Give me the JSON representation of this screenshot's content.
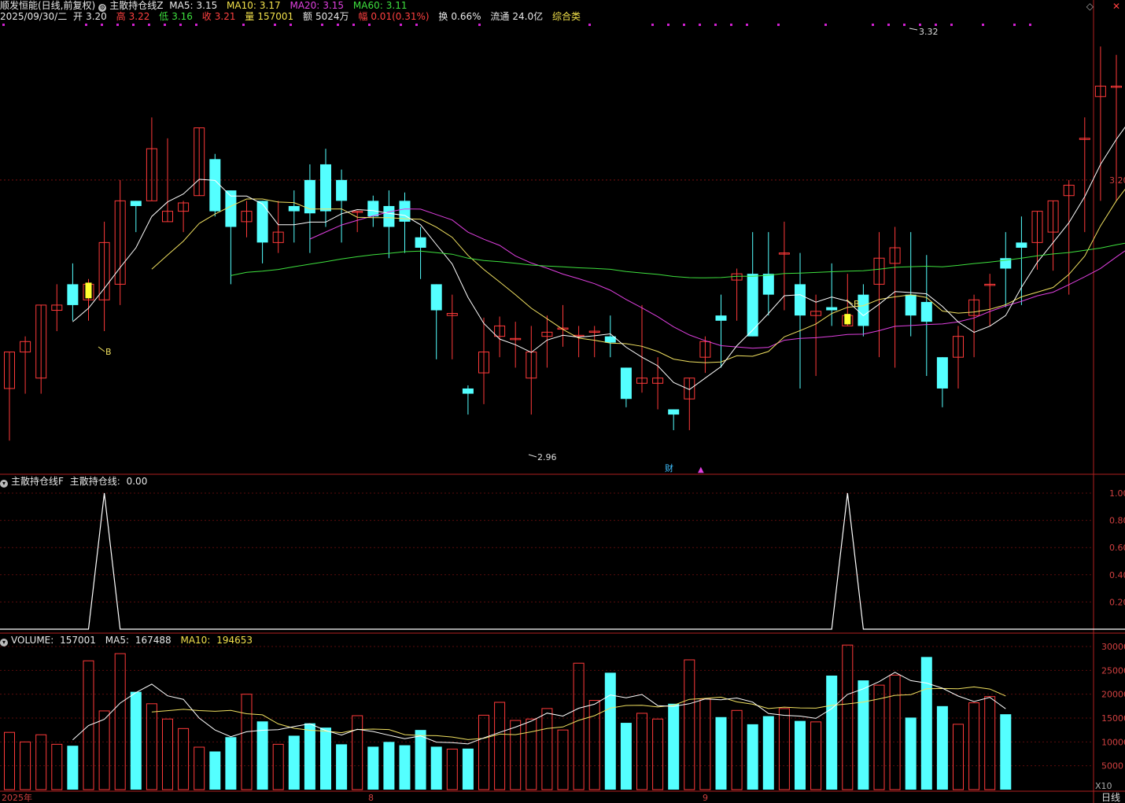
{
  "header": {
    "stock": "顺发恒能(日线,前复权)",
    "indicator": "主散持仓线Z",
    "ma5_label": "MA5:",
    "ma5_value": "3.15",
    "ma10_label": "MA10:",
    "ma10_value": "3.17",
    "ma20_label": "MA20:",
    "ma20_value": "3.15",
    "ma60_label": "MA60:",
    "ma60_value": "3.11",
    "line2_date": "2025/09/30/二",
    "open_label": "开",
    "open_value": "3.20",
    "high_label": "高",
    "high_value": "3.22",
    "low_label": "低",
    "low_value": "3.16",
    "close_label": "收",
    "close_value": "3.21",
    "vol_label": "量",
    "vol_value": "157001",
    "amount_label": "额",
    "amount_value": "5024万",
    "change_label": "幅",
    "change_value": "0.01(0.31%)",
    "turnover_label": "换",
    "turnover_value": "0.66%",
    "float_label": "流通",
    "float_value": "24.0亿",
    "category": "综合类"
  },
  "panel2_header": {
    "name": "主散持仓线F",
    "series_label": "主散持仓线:",
    "series_value": "0.00"
  },
  "panel3_header": {
    "name": "VOLUME:",
    "value": "157001",
    "ma5_label": "MA5:",
    "ma5_value": "167488",
    "ma10_label": "MA10:",
    "ma10_value": "194653"
  },
  "labels": {
    "price_max": "3.32",
    "price_min": "2.96",
    "b_mark": "B",
    "cai_mark": "财",
    "right_price": "3.20",
    "vol_unit": "X10",
    "period": "日线",
    "x_ticks": [
      "2025年",
      "8",
      "9"
    ]
  },
  "colors": {
    "up": "#ff3a3a",
    "down": "#54ffff",
    "ma5": "#ffffff",
    "ma10": "#f0e060",
    "ma20": "#e040e0",
    "ma60": "#3ee03e"
  },
  "chart_data": [
    {
      "type": "candlestick",
      "title": "主散持仓线Z",
      "ylim": [
        2.92,
        3.35
      ],
      "yticks": [
        "3.20"
      ],
      "candles": [
        {
          "o": 3.0,
          "h": 3.035,
          "l": 2.95,
          "c": 3.035
        },
        {
          "o": 3.035,
          "h": 3.05,
          "l": 2.995,
          "c": 3.045
        },
        {
          "o": 3.01,
          "h": 3.08,
          "l": 2.995,
          "c": 3.08
        },
        {
          "o": 3.075,
          "h": 3.1,
          "l": 3.055,
          "c": 3.08
        },
        {
          "o": 3.1,
          "h": 3.12,
          "l": 3.065,
          "c": 3.08
        },
        {
          "o": 3.085,
          "h": 3.105,
          "l": 3.065,
          "c": 3.1
        },
        {
          "o": 3.085,
          "h": 3.16,
          "l": 3.055,
          "c": 3.14
        },
        {
          "o": 3.1,
          "h": 3.2,
          "l": 3.08,
          "c": 3.18
        },
        {
          "o": 3.18,
          "h": 3.16,
          "l": 3.15,
          "c": 3.175
        },
        {
          "o": 3.18,
          "h": 3.26,
          "l": 3.18,
          "c": 3.23
        },
        {
          "o": 3.16,
          "h": 3.24,
          "l": 3.16,
          "c": 3.17
        },
        {
          "o": 3.17,
          "h": 3.18,
          "l": 3.15,
          "c": 3.178
        },
        {
          "o": 3.185,
          "h": 3.25,
          "l": 3.185,
          "c": 3.25
        },
        {
          "o": 3.22,
          "h": 3.225,
          "l": 3.165,
          "c": 3.17
        },
        {
          "o": 3.19,
          "h": 3.19,
          "l": 3.1,
          "c": 3.155
        },
        {
          "o": 3.16,
          "h": 3.18,
          "l": 3.145,
          "c": 3.17
        },
        {
          "o": 3.18,
          "h": 3.18,
          "l": 3.12,
          "c": 3.14
        },
        {
          "o": 3.14,
          "h": 3.18,
          "l": 3.13,
          "c": 3.15
        },
        {
          "o": 3.175,
          "h": 3.19,
          "l": 3.14,
          "c": 3.17
        },
        {
          "o": 3.2,
          "h": 3.215,
          "l": 3.13,
          "c": 3.168
        },
        {
          "o": 3.215,
          "h": 3.23,
          "l": 3.155,
          "c": 3.17
        },
        {
          "o": 3.2,
          "h": 3.21,
          "l": 3.14,
          "c": 3.18
        },
        {
          "o": 3.17,
          "h": 3.17,
          "l": 3.15,
          "c": 3.17
        },
        {
          "o": 3.18,
          "h": 3.185,
          "l": 3.155,
          "c": 3.165
        },
        {
          "o": 3.175,
          "h": 3.19,
          "l": 3.125,
          "c": 3.155
        },
        {
          "o": 3.18,
          "h": 3.188,
          "l": 3.13,
          "c": 3.16
        },
        {
          "o": 3.145,
          "h": 3.155,
          "l": 3.105,
          "c": 3.135
        },
        {
          "o": 3.1,
          "h": 3.1,
          "l": 3.028,
          "c": 3.075
        },
        {
          "o": 3.07,
          "h": 3.09,
          "l": 3.028,
          "c": 3.072
        },
        {
          "o": 3.0,
          "h": 3.003,
          "l": 2.975,
          "c": 2.995
        },
        {
          "o": 3.015,
          "h": 3.068,
          "l": 2.985,
          "c": 3.035
        },
        {
          "o": 3.05,
          "h": 3.069,
          "l": 3.03,
          "c": 3.06
        },
        {
          "o": 3.048,
          "h": 3.064,
          "l": 3.02,
          "c": 3.048
        },
        {
          "o": 3.01,
          "h": 3.06,
          "l": 2.975,
          "c": 3.035
        },
        {
          "o": 3.05,
          "h": 3.07,
          "l": 3.02,
          "c": 3.054
        },
        {
          "o": 3.058,
          "h": 3.08,
          "l": 3.04,
          "c": 3.058
        },
        {
          "o": 3.05,
          "h": 3.06,
          "l": 3.03,
          "c": 3.051
        },
        {
          "o": 3.055,
          "h": 3.06,
          "l": 3.03,
          "c": 3.055
        },
        {
          "o": 3.05,
          "h": 3.07,
          "l": 3.03,
          "c": 3.044
        },
        {
          "o": 3.02,
          "h": 3.02,
          "l": 2.982,
          "c": 2.99
        },
        {
          "o": 3.005,
          "h": 3.08,
          "l": 2.996,
          "c": 3.01
        },
        {
          "o": 3.005,
          "h": 3.03,
          "l": 2.98,
          "c": 3.01
        },
        {
          "o": 2.98,
          "h": 2.96,
          "l": 2.96,
          "c": 2.975
        },
        {
          "o": 2.99,
          "h": 3.005,
          "l": 2.96,
          "c": 3.01
        },
        {
          "o": 3.03,
          "h": 3.05,
          "l": 3.015,
          "c": 3.045
        },
        {
          "o": 3.07,
          "h": 3.09,
          "l": 3.02,
          "c": 3.065
        },
        {
          "o": 3.104,
          "h": 3.115,
          "l": 3.065,
          "c": 3.11
        },
        {
          "o": 3.11,
          "h": 3.15,
          "l": 3.05,
          "c": 3.05
        },
        {
          "o": 3.11,
          "h": 3.15,
          "l": 3.07,
          "c": 3.09
        },
        {
          "o": 3.13,
          "h": 3.16,
          "l": 3.075,
          "c": 3.13
        },
        {
          "o": 3.1,
          "h": 3.13,
          "l": 3.0,
          "c": 3.07
        },
        {
          "o": 3.07,
          "h": 3.09,
          "l": 3.012,
          "c": 3.074
        },
        {
          "o": 3.078,
          "h": 3.12,
          "l": 3.06,
          "c": 3.075
        },
        {
          "o": 3.06,
          "h": 3.11,
          "l": 3.06,
          "c": 3.07
        },
        {
          "o": 3.09,
          "h": 3.1,
          "l": 3.05,
          "c": 3.06
        },
        {
          "o": 3.1,
          "h": 3.15,
          "l": 3.03,
          "c": 3.125
        },
        {
          "o": 3.12,
          "h": 3.155,
          "l": 3.02,
          "c": 3.135
        },
        {
          "o": 3.09,
          "h": 3.15,
          "l": 3.05,
          "c": 3.07
        },
        {
          "o": 3.083,
          "h": 3.128,
          "l": 3.012,
          "c": 3.064
        },
        {
          "o": 3.03,
          "h": 3.028,
          "l": 2.982,
          "c": 3.0
        },
        {
          "o": 3.03,
          "h": 3.06,
          "l": 3.0,
          "c": 3.05
        },
        {
          "o": 3.07,
          "h": 3.09,
          "l": 3.03,
          "c": 3.085
        },
        {
          "o": 3.1,
          "h": 3.11,
          "l": 3.06,
          "c": 3.1
        },
        {
          "o": 3.125,
          "h": 3.15,
          "l": 3.078,
          "c": 3.115
        },
        {
          "o": 3.14,
          "h": 3.165,
          "l": 3.08,
          "c": 3.135
        },
        {
          "o": 3.14,
          "h": 3.17,
          "l": 3.114,
          "c": 3.17
        },
        {
          "o": 3.15,
          "h": 3.18,
          "l": 3.113,
          "c": 3.18
        },
        {
          "o": 3.185,
          "h": 3.2,
          "l": 3.09,
          "c": 3.195
        },
        {
          "o": 3.24,
          "h": 3.26,
          "l": 3.15,
          "c": 3.24
        },
        {
          "o": 3.28,
          "h": 3.328,
          "l": 3.18,
          "c": 3.29
        },
        {
          "o": 3.29,
          "h": 3.32,
          "l": 3.18,
          "c": 3.29
        },
        {
          "o": 3.25,
          "h": 3.328,
          "l": 3.185,
          "c": 3.285
        },
        {
          "o": 3.25,
          "h": 3.27,
          "l": 3.15,
          "c": 3.22
        },
        {
          "o": 3.21,
          "h": 3.23,
          "l": 3.18,
          "c": 3.215
        },
        {
          "o": 3.17,
          "h": 3.2,
          "l": 3.11,
          "c": 3.185
        },
        {
          "o": 3.17,
          "h": 3.17,
          "l": 3.04,
          "c": 3.06
        },
        {
          "o": 3.06,
          "h": 3.11,
          "l": 3.01,
          "c": 3.08
        },
        {
          "o": 3.15,
          "h": 3.19,
          "l": 3.07,
          "c": 3.18
        },
        {
          "o": 3.18,
          "h": 3.2,
          "l": 3.1,
          "c": 3.1
        },
        {
          "o": 3.12,
          "h": 3.205,
          "l": 3.09,
          "c": 3.19
        },
        {
          "o": 3.2,
          "h": 3.22,
          "l": 3.16,
          "c": 3.21
        }
      ]
    },
    {
      "type": "line",
      "title": "主散持仓线F",
      "ylim": [
        0,
        1
      ],
      "yticks": [
        "1.00",
        "0.80",
        "0.60",
        "0.40",
        "0.20"
      ],
      "series": [
        {
          "name": "主散持仓线",
          "spikes_at_index": [
            6,
            53
          ],
          "values_default": 0
        }
      ]
    },
    {
      "type": "bar",
      "title": "VOLUME",
      "ylim": [
        0,
        30000
      ],
      "yticks": [
        "30000",
        "25000",
        "20000",
        "15000",
        "10000",
        "5000"
      ],
      "values": [
        12000,
        10000,
        11500,
        9500,
        9200,
        27000,
        16500,
        28500,
        20500,
        18000,
        14800,
        12800,
        8900,
        8000,
        11000,
        20000,
        14300,
        9500,
        11300,
        13900,
        13000,
        9500,
        15500,
        9000,
        10000,
        9300,
        12500,
        9000,
        8500,
        8600,
        15600,
        18300,
        14500,
        14800,
        17000,
        12500,
        26500,
        18700,
        24500,
        14000,
        16000,
        14800,
        18000,
        27200,
        19000,
        15200,
        16600,
        13700,
        15400,
        17000,
        14400,
        14200,
        23900,
        30300,
        22900,
        21900,
        24000,
        15100,
        27800,
        17500,
        13700,
        18200,
        19500,
        15800
      ]
    }
  ]
}
